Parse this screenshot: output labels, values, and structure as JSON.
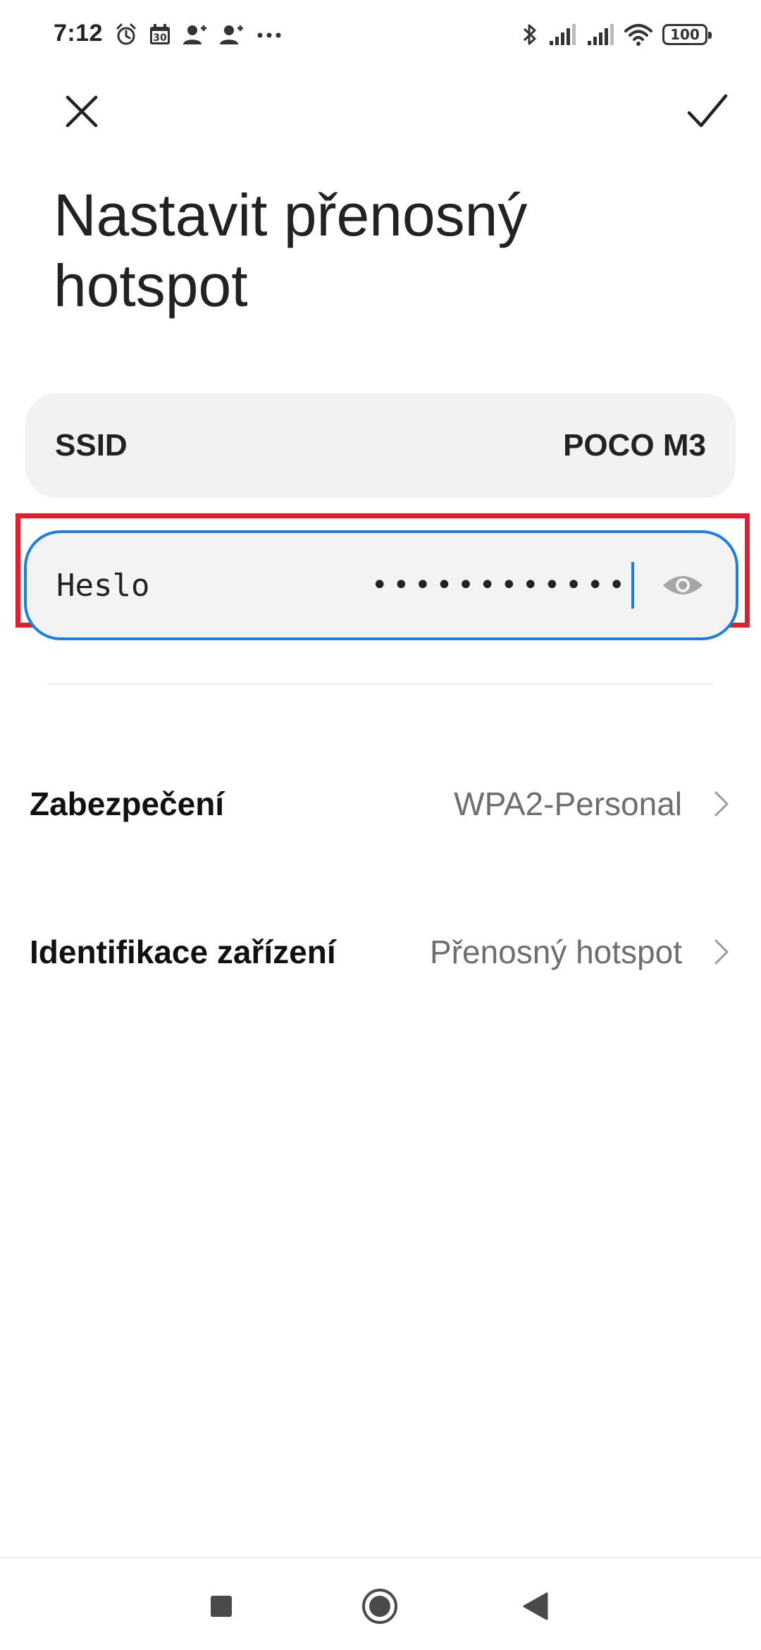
{
  "status_bar": {
    "time": "7:12",
    "calendar_day": "30",
    "battery": "100",
    "left_icons": [
      "alarm-icon",
      "calendar-icon",
      "person-add-icon",
      "person-add-icon",
      "more-dots-icon"
    ],
    "right_icons": [
      "bluetooth-icon",
      "signal-icon",
      "signal-icon",
      "wifi-icon",
      "battery-icon"
    ]
  },
  "toolbar": {
    "close_icon": "close-icon",
    "confirm_icon": "check-icon"
  },
  "page": {
    "title": "Nastavit přenosný hotspot"
  },
  "ssid": {
    "label": "SSID",
    "value": "POCO M3"
  },
  "password": {
    "label": "Heslo",
    "masked_value": "••••••••••••",
    "focused": true,
    "visibility_icon": "eye-icon"
  },
  "settings": [
    {
      "label": "Zabezpečení",
      "value": "WPA2-Personal"
    },
    {
      "label": "Identifikace zařízení",
      "value": "Přenosný hotspot"
    }
  ],
  "nav_bar": {
    "buttons": [
      "recents-square-icon",
      "home-circle-icon",
      "back-triangle-icon"
    ]
  },
  "colors": {
    "focus_border": "#1a7fe0",
    "highlight_box": "#e2202d",
    "card_background": "#f2f2f2",
    "secondary_text": "#6e6e6e"
  }
}
